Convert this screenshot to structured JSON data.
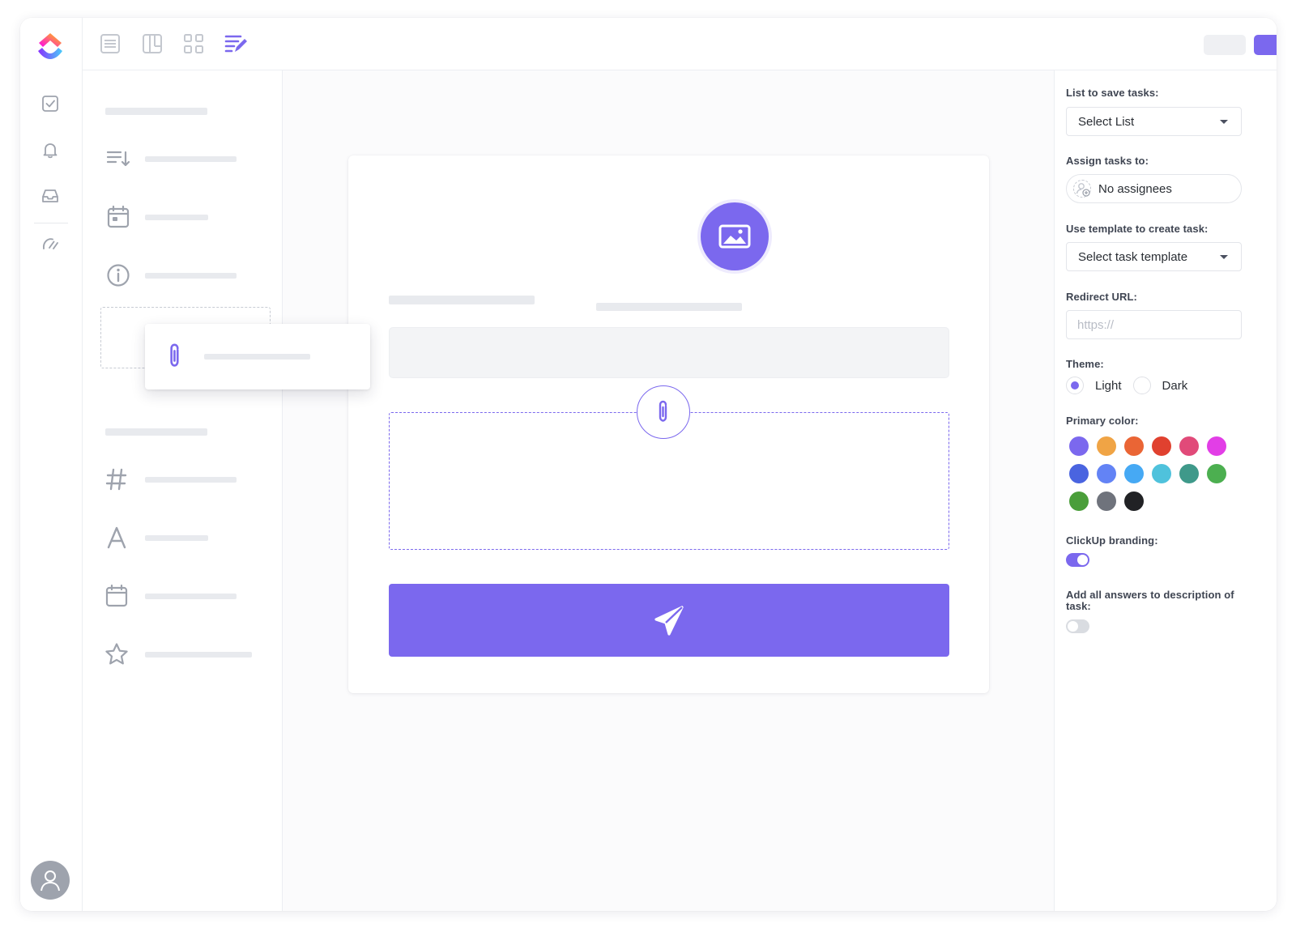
{
  "settings": {
    "list_label": "List to save tasks:",
    "list_value": "Select List",
    "assign_label": "Assign tasks to:",
    "assign_value": "No assignees",
    "template_label": "Use template to create task:",
    "template_value": "Select task template",
    "redirect_label": "Redirect URL:",
    "redirect_placeholder": "https://",
    "theme_label": "Theme:",
    "theme_light": "Light",
    "theme_dark": "Dark",
    "theme_selected": "Light",
    "primary_color_label": "Primary color:",
    "primary_colors": [
      "#7b68ee",
      "#f0a445",
      "#ea6535",
      "#e0412f",
      "#e14a79",
      "#e23ee6",
      "#4a64e0",
      "#6383f5",
      "#46a9f4",
      "#4fc2dc",
      "#3f998a",
      "#4caf50",
      "#4a9e3a",
      "#6f737c",
      "#212225"
    ],
    "branding_label": "ClickUp branding:",
    "branding_on": true,
    "answers_label": "Add all answers to description of task:",
    "answers_on": false
  },
  "colors": {
    "accent": "#7b68ee"
  }
}
